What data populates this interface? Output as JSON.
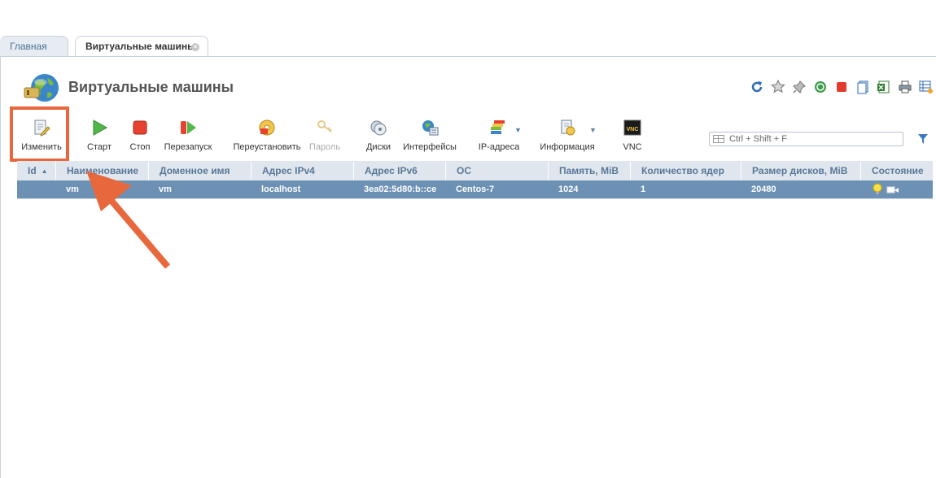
{
  "tabs": {
    "main": "Главная",
    "vms": "Виртуальные машины"
  },
  "page_title": "Виртуальные машины",
  "toolbar": {
    "edit": "Изменить",
    "start": "Старт",
    "stop": "Стоп",
    "restart": "Перезапуск",
    "reinstall": "Переустановить",
    "password": "Пароль",
    "disks": "Диски",
    "interfaces": "Интерфейсы",
    "ip": "IP-адреса",
    "info": "Информация",
    "vnc": "VNC"
  },
  "search": {
    "placeholder": "Ctrl + Shift + F"
  },
  "table": {
    "columns": [
      "Id",
      "Наименование",
      "Доменное имя",
      "Адрес IPv4",
      "Адрес IPv6",
      "ОС",
      "Память, MiB",
      "Количество ядер",
      "Размер дисков, MiB",
      "Состояние"
    ],
    "rows": [
      {
        "id": "",
        "name": "vm",
        "domain": "vm",
        "ipv4": "localhost",
        "ipv6": "3ea02:5d80:b::ce",
        "os": "Centos-7",
        "memory": "1024",
        "cores": "1",
        "disk": "20480"
      }
    ]
  },
  "colors": {
    "accent": "#e8683e",
    "selected_row": "#6c91b5",
    "header_bg": "#dfe6ee"
  },
  "icons": {
    "top_right": [
      "refresh-icon",
      "star-icon",
      "pin-icon",
      "globe-link-icon",
      "stop-red-icon",
      "copy-icon",
      "excel-icon",
      "print-icon",
      "table-settings-icon"
    ]
  }
}
